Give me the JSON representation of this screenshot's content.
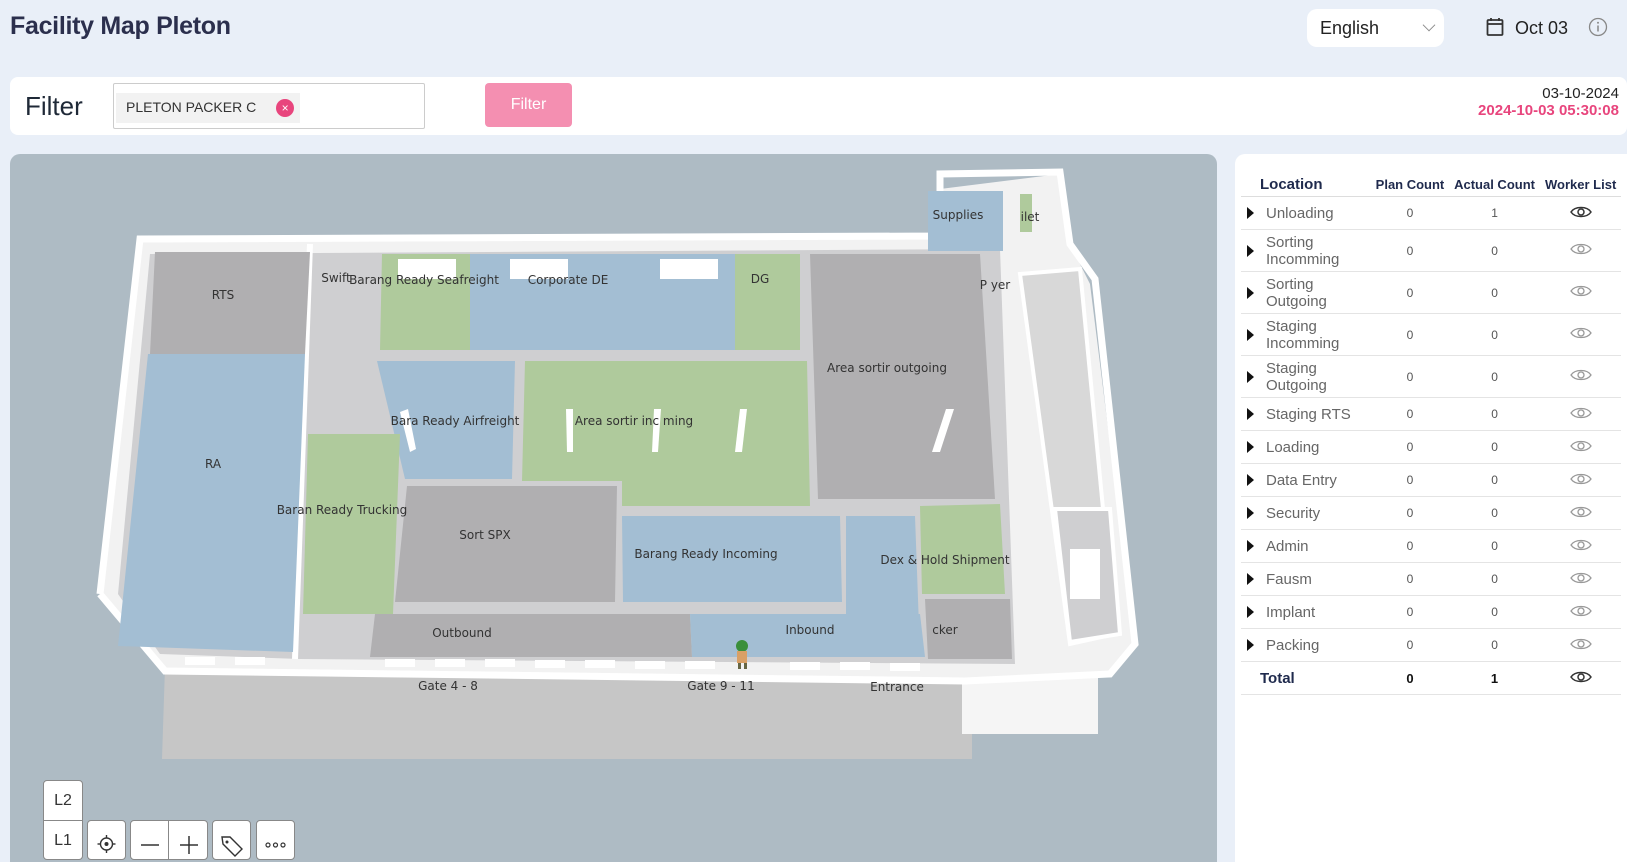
{
  "header": {
    "title": "Facility Map Pleton",
    "language": "English",
    "date": "Oct 03"
  },
  "filter": {
    "label": "Filter",
    "chip": "PLETON PACKER C",
    "chip_remove": "×",
    "button": "Filter",
    "stamp_date": "03-10-2024",
    "stamp_datetime": "2024-10-03 05:30:08"
  },
  "map": {
    "labels": {
      "rts": "RTS",
      "swift": "Swift",
      "seafreight": "Barang Ready Seafreight",
      "corporate": "Corporate DE",
      "dg": "DG",
      "supplies": "Supplies",
      "toilet": "ilet",
      "prayer": "P     yer",
      "ra": "RA",
      "airfreight": "Bara   Ready Airfreight",
      "sortir_in": "Area sortir inc  ming",
      "sortir_out": "Area sortir outgoing",
      "trucking": "Baran  Ready Trucking",
      "sort_spx": "Sort SPX",
      "br_incoming": "Barang Ready Incoming",
      "dex_hold": "Dex & Hold Shipment",
      "outbound": "Outbound",
      "inbound": "Inbound",
      "locker": "   cker",
      "gate48": "Gate 4 - 8",
      "gate911": "Gate 9 - 11",
      "entrance": "Entrance"
    },
    "levels": [
      "L2",
      "L1"
    ],
    "tools": [
      "locate-icon",
      "zoom-out-icon",
      "zoom-in-icon",
      "tag-icon",
      "more-icon"
    ]
  },
  "table": {
    "headers": {
      "location": "Location",
      "plan": "Plan Count",
      "actual": "Actual Count",
      "workers": "Worker List"
    },
    "rows": [
      {
        "location": "Unloading",
        "plan": "0",
        "actual": "1"
      },
      {
        "location": "Sorting Incomming",
        "plan": "0",
        "actual": "0"
      },
      {
        "location": "Sorting Outgoing",
        "plan": "0",
        "actual": "0"
      },
      {
        "location": "Staging Incomming",
        "plan": "0",
        "actual": "0"
      },
      {
        "location": "Staging Outgoing",
        "plan": "0",
        "actual": "0"
      },
      {
        "location": "Staging RTS",
        "plan": "0",
        "actual": "0"
      },
      {
        "location": "Loading",
        "plan": "0",
        "actual": "0"
      },
      {
        "location": "Data Entry",
        "plan": "0",
        "actual": "0"
      },
      {
        "location": "Security",
        "plan": "0",
        "actual": "0"
      },
      {
        "location": "Admin",
        "plan": "0",
        "actual": "0"
      },
      {
        "location": "Fausm",
        "plan": "0",
        "actual": "0"
      },
      {
        "location": "Implant",
        "plan": "0",
        "actual": "0"
      },
      {
        "location": "Packing",
        "plan": "0",
        "actual": "0"
      }
    ],
    "total": {
      "label": "Total",
      "plan": "0",
      "actual": "1"
    }
  },
  "colors": {
    "accent": "#e8457d",
    "button": "#f48fb1",
    "blue_zone": "#a3bed3",
    "green_zone": "#afca9c",
    "grey_zone": "#b0afb1"
  }
}
